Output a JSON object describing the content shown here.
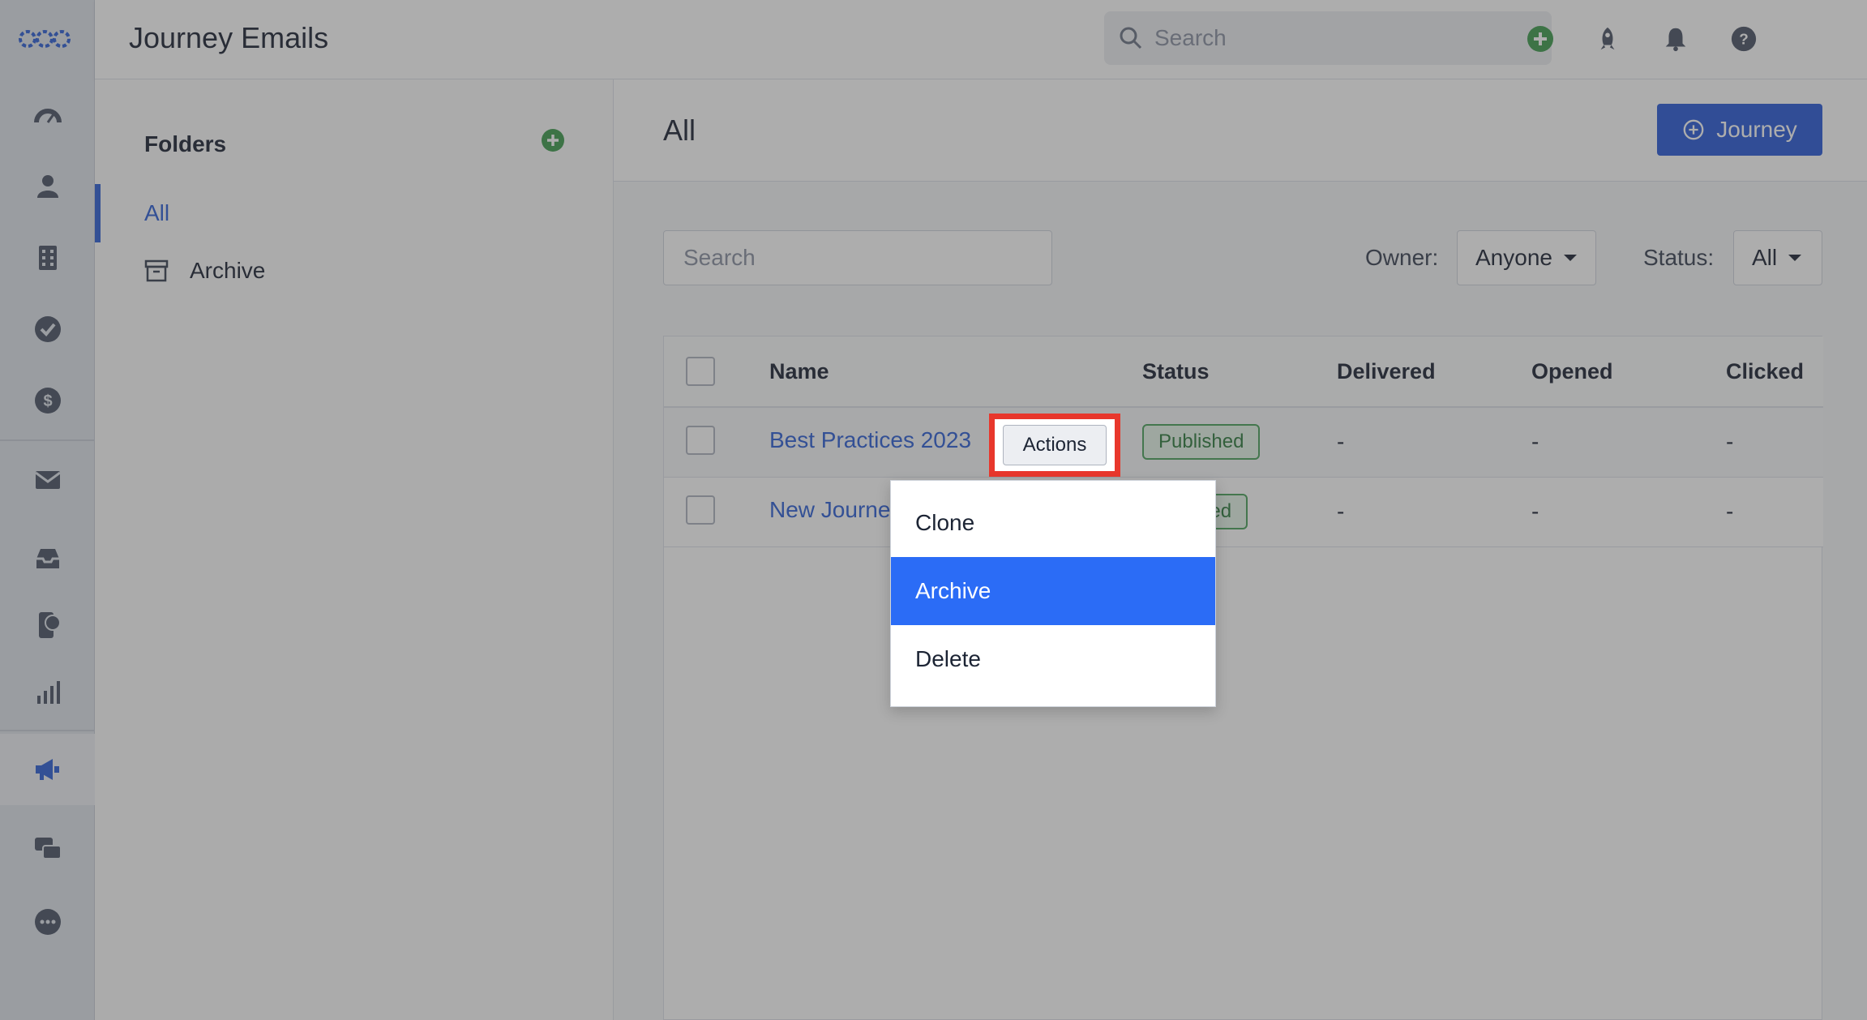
{
  "app": {
    "title": "Journey Emails"
  },
  "topbar": {
    "search_placeholder": "Search"
  },
  "folders": {
    "heading": "Folders",
    "items": [
      {
        "label": "All",
        "active": true
      },
      {
        "label": "Archive",
        "active": false
      }
    ]
  },
  "main": {
    "heading": "All",
    "new_button_label": "Journey",
    "search_placeholder": "Search",
    "owner_label": "Owner:",
    "owner_value": "Anyone",
    "status_label": "Status:",
    "status_value": "All"
  },
  "table": {
    "columns": [
      "Name",
      "Status",
      "Delivered",
      "Opened",
      "Clicked"
    ],
    "rows": [
      {
        "name": "Best Practices 2023",
        "status": "Published",
        "delivered": "-",
        "opened": "-",
        "clicked": "-"
      },
      {
        "name": "New Journe",
        "status": "hed",
        "delivered": "-",
        "opened": "-",
        "clicked": "-"
      }
    ]
  },
  "actions": {
    "button_label": "Actions",
    "menu": [
      "Clone",
      "Archive",
      "Delete"
    ],
    "highlighted": "Archive"
  },
  "colors": {
    "primary": "#2a5bd7",
    "highlight_border": "#e8372c",
    "published_green": "#4aa35c"
  }
}
